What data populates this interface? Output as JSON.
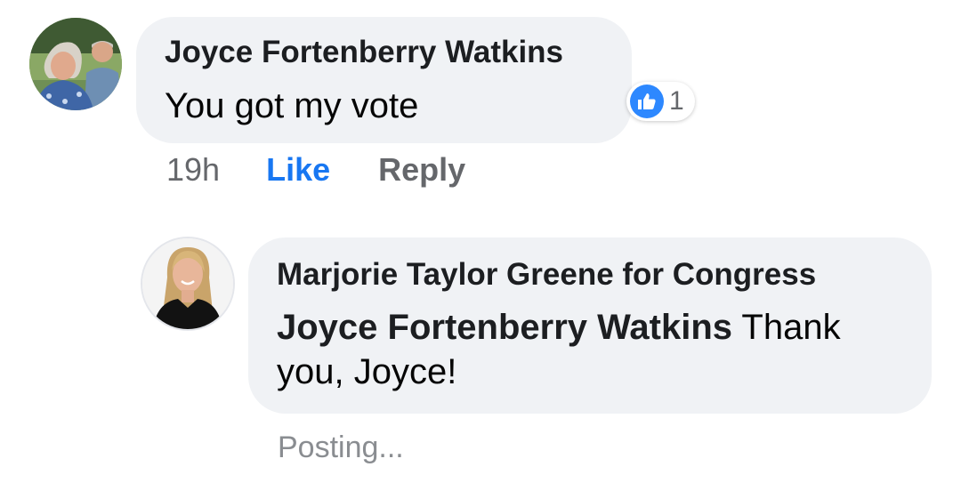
{
  "comment": {
    "author": "Joyce Fortenberry Watkins",
    "text": "You got my vote",
    "timestamp": "19h",
    "like_label": "Like",
    "reply_label": "Reply",
    "reaction": {
      "icon": "thumbs-up-icon",
      "count": "1",
      "color": "#2d88ff"
    }
  },
  "reply": {
    "author": "Marjorie Taylor Greene for Congress",
    "mention": "Joyce Fortenberry Watkins",
    "text": " Thank you, Joyce!",
    "status": "Posting..."
  },
  "colors": {
    "bubble": "#f0f2f5",
    "link_blue": "#1877f2",
    "secondary_text": "#65676b"
  }
}
